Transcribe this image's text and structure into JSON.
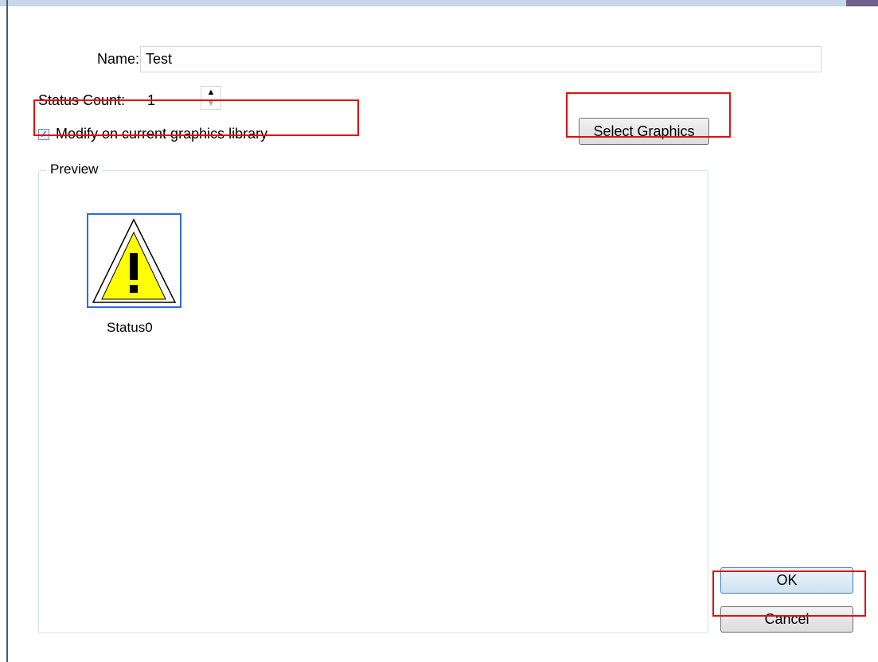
{
  "form": {
    "name_label": "Name:",
    "name_value": "Test",
    "status_count_label": "Status Count:",
    "status_count_value": "1",
    "modify_checkbox_label": "Modify on current graphics library",
    "modify_checked": true,
    "select_graphics_label": "Select Graphics"
  },
  "preview": {
    "legend": "Preview",
    "items": [
      {
        "label": "Status0",
        "icon": "warning-triangle-icon",
        "selected": true
      }
    ]
  },
  "buttons": {
    "ok_label": "OK",
    "cancel_label": "Cancel"
  },
  "colors": {
    "annotation": "#e01010",
    "selection": "#2f6ae0",
    "warning_fill": "#ffff00"
  }
}
